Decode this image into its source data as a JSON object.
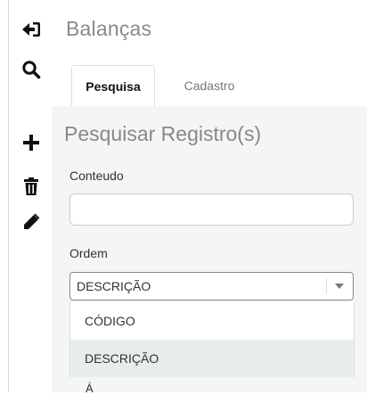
{
  "page": {
    "title": "Balanças"
  },
  "toolbar": {
    "items": [
      {
        "icon": "sign-out-icon"
      },
      {
        "icon": "search-icon"
      },
      {
        "icon": "plus-icon"
      },
      {
        "icon": "trash-icon"
      },
      {
        "icon": "pencil-icon"
      }
    ]
  },
  "tabs": [
    {
      "label": "Pesquisa",
      "active": true
    },
    {
      "label": "Cadastro",
      "active": false
    }
  ],
  "search_panel": {
    "title": "Pesquisar Registro(s)",
    "content_label": "Conteudo",
    "content_value": "",
    "order_label": "Ordem",
    "order_selected": "DESCRIÇÃO",
    "order_options": [
      "CÓDIGO",
      "DESCRIÇÃO"
    ],
    "cut_text": "Á"
  },
  "colors": {
    "panel_bg": "#f4f5f5",
    "highlight": "#e8edec",
    "title_grey": "#8a8a8a"
  }
}
